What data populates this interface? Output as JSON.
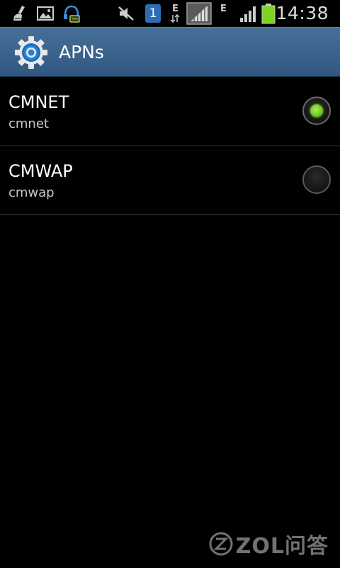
{
  "status_bar": {
    "time": "14:38",
    "notification_count": "1",
    "network_type_1": "E",
    "network_type_2": "E",
    "icons": [
      "broom-icon",
      "image-icon",
      "chat-headset-icon",
      "mute-icon",
      "badge-1-icon",
      "data-arrows-icon",
      "signal-icon",
      "signal-icon",
      "battery-icon"
    ],
    "battery_color": "#7ed321"
  },
  "title_bar": {
    "title": "APNs",
    "icon": "gear-icon",
    "background": "#3a638c"
  },
  "apn_list": [
    {
      "name": "CMNET",
      "apn": "cmnet",
      "selected": true
    },
    {
      "name": "CMWAP",
      "apn": "cmwap",
      "selected": false
    }
  ],
  "colors": {
    "accent_green": "#7ed43a"
  },
  "watermark": {
    "text": "ZOL问答"
  }
}
